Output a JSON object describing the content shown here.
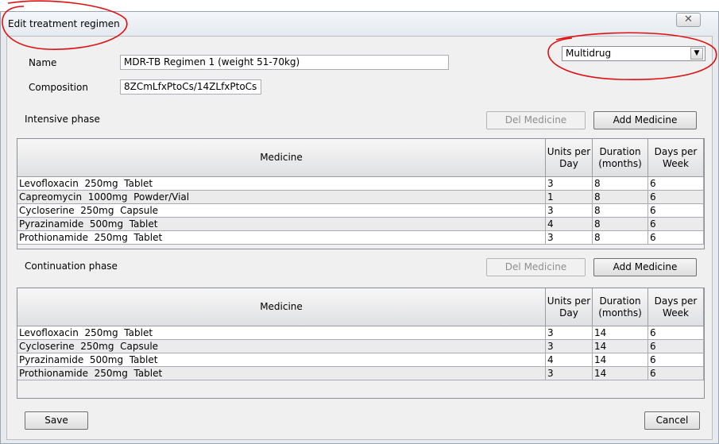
{
  "window": {
    "title": "Edit treatment regimen",
    "close_icon": "close-icon"
  },
  "form": {
    "name_label": "Name",
    "name_value": "MDR-TB Regimen 1 (weight 51-70kg)",
    "composition_label": "Composition",
    "composition_value": "8ZCmLfxPtoCs/14ZLfxPtoCs",
    "type_select": {
      "value": "Multidrug",
      "icon": "chevron-down-icon"
    }
  },
  "intensive": {
    "label": "Intensive phase",
    "del_button": "Del Medicine",
    "add_button": "Add Medicine",
    "headers": [
      "Medicine",
      "Units per Day",
      "Duration (months)",
      "Days per Week"
    ],
    "rows": [
      [
        "Levofloxacin  250mg  Tablet",
        "3",
        "8",
        "6"
      ],
      [
        "Capreomycin  1000mg  Powder/Vial",
        "1",
        "8",
        "6"
      ],
      [
        "Cycloserine  250mg  Capsule",
        "3",
        "8",
        "6"
      ],
      [
        "Pyrazinamide  500mg  Tablet",
        "4",
        "8",
        "6"
      ],
      [
        "Prothionamide  250mg  Tablet",
        "3",
        "8",
        "6"
      ]
    ]
  },
  "continuation": {
    "label": "Continuation phase",
    "del_button": "Del Medicine",
    "add_button": "Add Medicine",
    "headers": [
      "Medicine",
      "Units per Day",
      "Duration (months)",
      "Days per Week"
    ],
    "rows": [
      [
        "Levofloxacin  250mg  Tablet",
        "3",
        "14",
        "6"
      ],
      [
        "Cycloserine  250mg  Capsule",
        "3",
        "14",
        "6"
      ],
      [
        "Pyrazinamide  500mg  Tablet",
        "4",
        "14",
        "6"
      ],
      [
        "Prothionamide  250mg  Tablet",
        "3",
        "14",
        "6"
      ]
    ]
  },
  "footer": {
    "save_button": "Save",
    "cancel_button": "Cancel"
  },
  "colors": {
    "annotation": "#e01010",
    "client_bg": "#f0f0f0"
  }
}
